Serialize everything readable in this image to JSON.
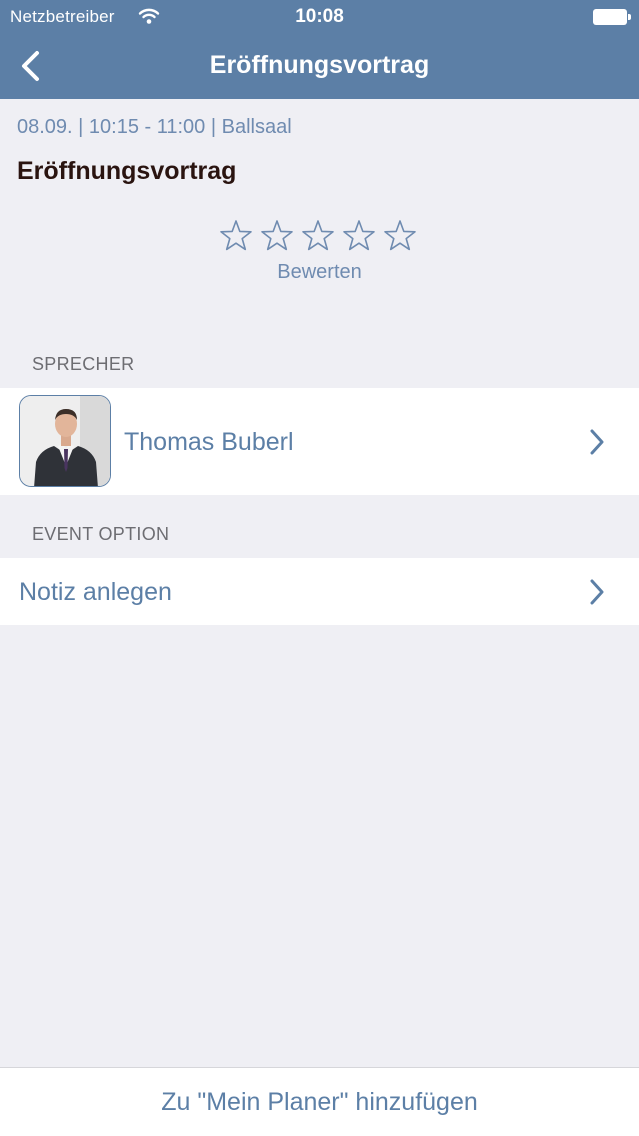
{
  "status_bar": {
    "carrier": "Netzbetreiber",
    "time": "10:08"
  },
  "nav": {
    "title": "Eröffnungsvortrag",
    "back_icon": "chevron-left-icon"
  },
  "event": {
    "meta": "08.09. | 10:15 - 11:00 | Ballsaal",
    "title": "Eröffnungsvortrag"
  },
  "rating": {
    "stars_filled": 0,
    "stars_total": 5,
    "label": "Bewerten"
  },
  "speakers_section": {
    "header": "SPRECHER",
    "items": [
      {
        "name": "Thomas Buberl"
      }
    ]
  },
  "options_section": {
    "header": "EVENT OPTION",
    "items": [
      {
        "label": "Notiz anlegen"
      }
    ]
  },
  "footer": {
    "action_label": "Zu \"Mein Planer\" hinzufügen"
  },
  "colors": {
    "accent": "#5c7fa6",
    "background": "#efeff4",
    "title_text": "#2a1410"
  }
}
